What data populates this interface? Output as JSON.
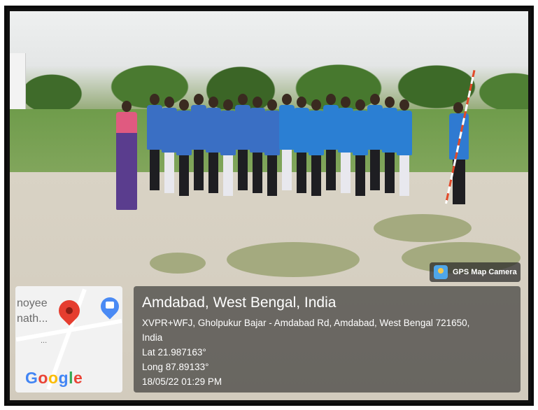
{
  "map": {
    "place_partial_1": "noyee",
    "place_partial_2": "nath...",
    "place_partial_3": "...",
    "logo_text": "Google",
    "pin_icon": "map-pin-icon",
    "bag_icon": "shopping-bag-marker-icon"
  },
  "location": {
    "title": "Amdabad, West Bengal, India",
    "address_line_1": "XVPR+WFJ, Gholpukur Bajar - Amdabad Rd, Amdabad, West Bengal 721650,",
    "address_line_2": "India",
    "lat": "Lat 21.987163°",
    "long": "Long 87.89133°",
    "datetime": "18/05/22 01:29 PM"
  },
  "badge": {
    "label": "GPS Map Camera",
    "icon": "gps-map-camera-icon"
  },
  "colors": {
    "pin": "#e53d2f",
    "google_blue": "#4285f4",
    "google_red": "#ea4335",
    "google_yellow": "#fbbc05",
    "google_green": "#34a853"
  }
}
